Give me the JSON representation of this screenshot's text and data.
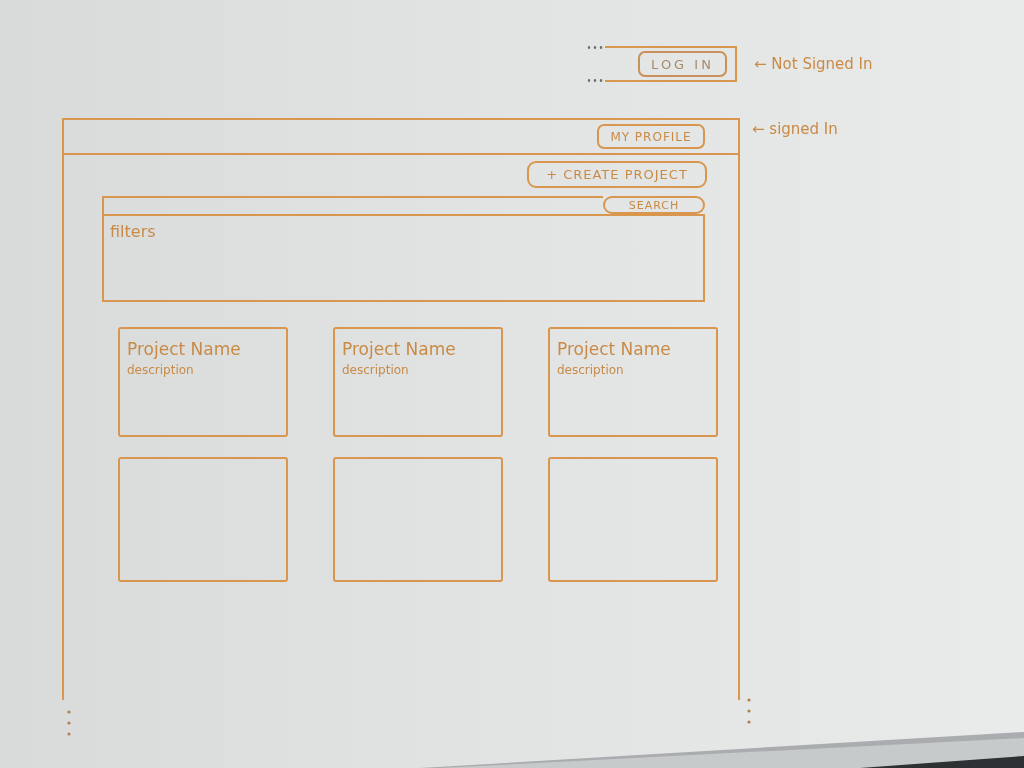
{
  "signed_out_header": {
    "button": "LOG IN",
    "note": "← Not Signed In"
  },
  "page": {
    "header": {
      "button": "MY PROFILE",
      "note": "← signed In"
    },
    "create_button": {
      "label": "+ CREATE PROJECT"
    },
    "search": {
      "button": "SEARCH"
    },
    "filters": {
      "label": "filters"
    },
    "projects": [
      {
        "kind": "filled",
        "name": "Project Name",
        "description": "description"
      },
      {
        "kind": "filled",
        "name": "Project Name",
        "description": "description"
      },
      {
        "kind": "filled",
        "name": "Project Name",
        "description": "description"
      },
      {
        "kind": "blank"
      },
      {
        "kind": "blank"
      },
      {
        "kind": "blank"
      }
    ]
  }
}
